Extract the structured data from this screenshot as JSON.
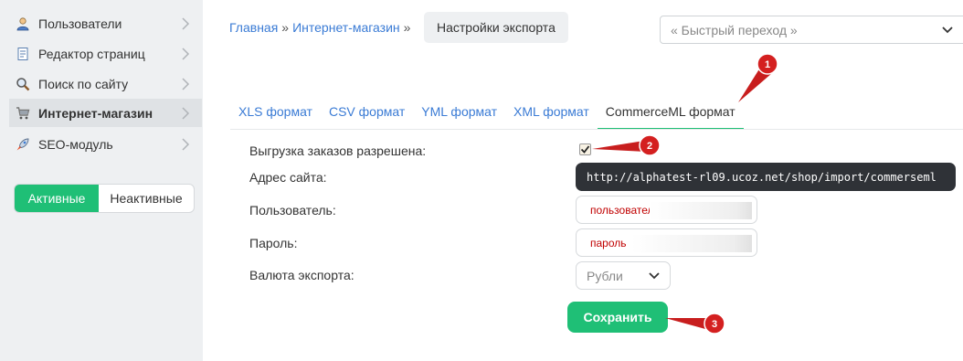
{
  "sidebar": {
    "items": [
      {
        "label": "Пользователи",
        "icon": "users-icon"
      },
      {
        "label": "Редактор страниц",
        "icon": "page-editor-icon"
      },
      {
        "label": "Поиск по сайту",
        "icon": "search-icon"
      },
      {
        "label": "Интернет-магазин",
        "icon": "shopping-cart-icon"
      },
      {
        "label": "SEO-модуль",
        "icon": "rocket-icon"
      }
    ],
    "active_index": 3,
    "toggle": {
      "active_label": "Активные",
      "inactive_label": "Неактивные"
    }
  },
  "header": {
    "breadcrumb": [
      "Главная",
      "Интернет-магазин"
    ],
    "separator": "»",
    "current": "Настройки экспорта",
    "quick_jump_placeholder": "« Быстрый переход »"
  },
  "tabs": {
    "items": [
      "XLS формат",
      "CSV формат",
      "YML формат",
      "XML формат",
      "CommerceML формат"
    ],
    "active_index": 4
  },
  "form": {
    "orders_export_label": "Выгрузка заказов разрешена:",
    "orders_export_checked": true,
    "site_address_label": "Адрес сайта:",
    "site_address_value": "http://alphatest-rl09.ucoz.net/shop/import/commerseml",
    "user_label": "Пользователь:",
    "user_value": "пользователь",
    "password_label": "Пароль:",
    "password_value": "пароль",
    "currency_label": "Валюта экспорта:",
    "currency_value": "Рубли",
    "save_label": "Сохранить"
  },
  "annotations": [
    "1",
    "2",
    "3"
  ],
  "colors": {
    "accent_green": "#1fbf76",
    "link_blue": "#3a7bd5",
    "annotation_red": "#d42020",
    "sidebar_bg": "#eef0f2"
  }
}
